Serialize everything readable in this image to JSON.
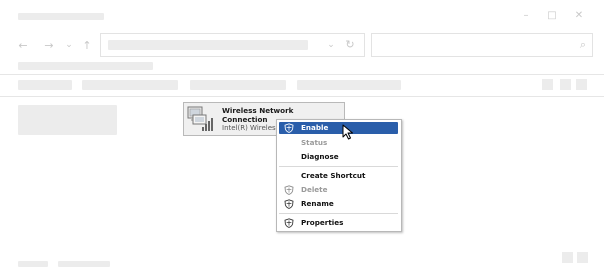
{
  "window": {
    "controls": {
      "minimize": "–",
      "maximize": "□",
      "close": "✕"
    }
  },
  "nav": {
    "back": "←",
    "forward": "→",
    "recent": "⌄",
    "up": "↑"
  },
  "address": {
    "dropdown": "⌄",
    "refresh": "↻"
  },
  "search": {
    "icon": "⌕"
  },
  "network_item": {
    "name_line1": "Wireless Network",
    "name_line2": "Connection",
    "device": "Intel(R) Wireless"
  },
  "context_menu": {
    "items": [
      {
        "label": "Enable",
        "icon": "shield-icon",
        "state": "highlighted"
      },
      {
        "label": "Status",
        "state": "disabled"
      },
      {
        "label": "Diagnose",
        "state": "normal"
      },
      {
        "label": "Create Shortcut",
        "state": "normal"
      },
      {
        "label": "Delete",
        "icon": "shield-icon",
        "state": "disabled"
      },
      {
        "label": "Rename",
        "icon": "shield-icon",
        "state": "normal"
      },
      {
        "label": "Properties",
        "icon": "shield-icon",
        "state": "normal"
      }
    ]
  },
  "colors": {
    "highlight": "#2a5eaa",
    "placeholder": "#ececec"
  }
}
